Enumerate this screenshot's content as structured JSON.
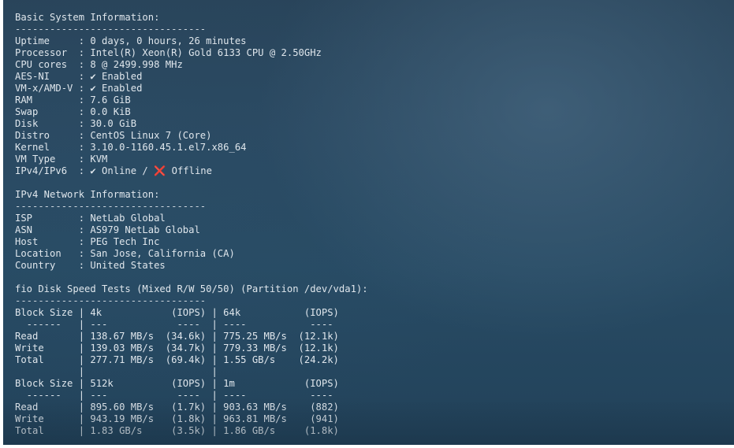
{
  "terminal": {
    "lines": [
      "Basic System Information:",
      "---------------------------------",
      "Uptime     : 0 days, 0 hours, 26 minutes",
      "Processor  : Intel(R) Xeon(R) Gold 6133 CPU @ 2.50GHz",
      "CPU cores  : 8 @ 2499.998 MHz",
      "AES-NI     : ✔ Enabled",
      "VM-x/AMD-V : ✔ Enabled",
      "RAM        : 7.6 GiB",
      "Swap       : 0.0 KiB",
      "Disk       : 30.0 GiB",
      "Distro     : CentOS Linux 7 (Core)",
      "Kernel     : 3.10.0-1160.45.1.el7.x86_64",
      "VM Type    : KVM",
      "IPv4/IPv6  : ✔ Online / ❌ Offline",
      "",
      "IPv4 Network Information:",
      "---------------------------------",
      "ISP        : NetLab Global",
      "ASN        : AS979 NetLab Global",
      "Host       : PEG Tech Inc",
      "Location   : San Jose, California (CA)",
      "Country    : United States",
      "",
      "fio Disk Speed Tests (Mixed R/W 50/50) (Partition /dev/vda1):",
      "---------------------------------",
      "Block Size | 4k            (IOPS) | 64k           (IOPS)",
      "  ------   | ---            ----  | ----           ---- ",
      "Read       | 138.67 MB/s  (34.6k) | 775.25 MB/s  (12.1k)",
      "Write      | 139.03 MB/s  (34.7k) | 779.33 MB/s  (12.1k)",
      "Total      | 277.71 MB/s  (69.4k) | 1.55 GB/s    (24.2k)",
      "           |                      |                     ",
      "Block Size | 512k          (IOPS) | 1m            (IOPS)",
      "  ------   | ---            ----  | ----           ---- ",
      "Read       | 895.60 MB/s   (1.7k) | 903.63 MB/s    (882)",
      "Write      | 943.19 MB/s   (1.8k) | 963.81 MB/s    (941)",
      "Total      | 1.83 GB/s     (3.5k) | 1.86 GB/s     (1.8k)"
    ]
  },
  "colors": {
    "text": "#dfe6ec",
    "background_top": "#29445a",
    "background_bottom": "#22425a"
  }
}
